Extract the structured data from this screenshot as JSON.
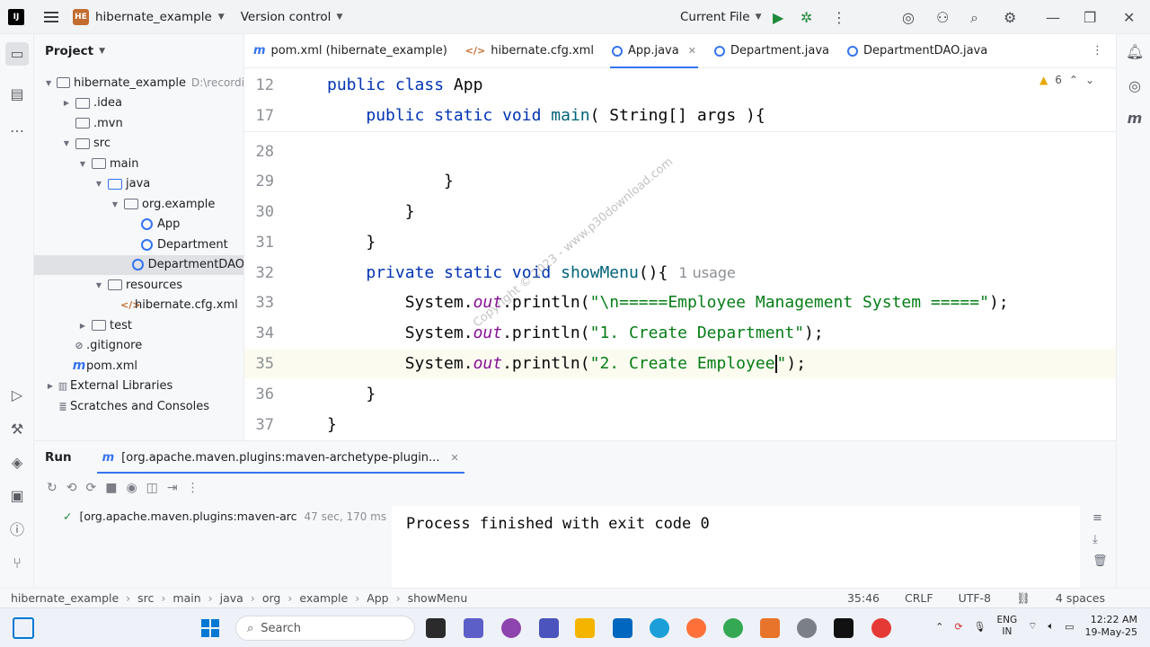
{
  "titlebar": {
    "project_badge": "HE",
    "project_name": "hibernate_example",
    "version_control": "Version control",
    "current_file": "Current File"
  },
  "project_panel": {
    "title": "Project",
    "tree": [
      {
        "label": "hibernate_example",
        "sub": "D:\\recordi",
        "indent": 0,
        "arrow": "▼",
        "icon": "folder"
      },
      {
        "label": ".idea",
        "indent": 1,
        "arrow": "▶",
        "icon": "folder"
      },
      {
        "label": ".mvn",
        "indent": 1,
        "arrow": "",
        "icon": "folder"
      },
      {
        "label": "src",
        "indent": 1,
        "arrow": "▼",
        "icon": "folder"
      },
      {
        "label": "main",
        "indent": 2,
        "arrow": "▼",
        "icon": "folder"
      },
      {
        "label": "java",
        "indent": 3,
        "arrow": "▼",
        "icon": "folder-blue"
      },
      {
        "label": "org.example",
        "indent": 4,
        "arrow": "▼",
        "icon": "folder"
      },
      {
        "label": "App",
        "indent": 5,
        "arrow": "",
        "icon": "class"
      },
      {
        "label": "Department",
        "indent": 5,
        "arrow": "",
        "icon": "class"
      },
      {
        "label": "DepartmentDAO",
        "indent": 5,
        "arrow": "",
        "icon": "class",
        "selected": true
      },
      {
        "label": "resources",
        "indent": 3,
        "arrow": "▼",
        "icon": "folder-res"
      },
      {
        "label": "hibernate.cfg.xml",
        "indent": 4,
        "arrow": "",
        "icon": "xml"
      },
      {
        "label": "test",
        "indent": 2,
        "arrow": "▶",
        "icon": "folder"
      },
      {
        "label": ".gitignore",
        "indent": 1,
        "arrow": "",
        "icon": "gitignore"
      },
      {
        "label": "pom.xml",
        "indent": 1,
        "arrow": "",
        "icon": "maven"
      },
      {
        "label": "External Libraries",
        "indent": 0,
        "arrow": "▶",
        "icon": "library"
      },
      {
        "label": "Scratches and Consoles",
        "indent": 0,
        "arrow": "",
        "icon": "scratch"
      }
    ]
  },
  "tabs": [
    {
      "label": "pom.xml (hibernate_example)",
      "icon": "m",
      "active": false
    },
    {
      "label": "hibernate.cfg.xml",
      "icon": "x",
      "active": false
    },
    {
      "label": "App.java",
      "icon": "c",
      "active": true
    },
    {
      "label": "Department.java",
      "icon": "c",
      "active": false
    },
    {
      "label": "DepartmentDAO.java",
      "icon": "c",
      "active": false
    }
  ],
  "editor": {
    "warnings_count": "6",
    "usage_hint": "1 usage",
    "watermark": "Copyright © 2023 - www.p30download.com",
    "lines": [
      {
        "n": "12",
        "parts": [
          [
            "kw",
            "public class "
          ],
          [
            "",
            "App"
          ]
        ]
      },
      {
        "n": "17",
        "parts": [
          [
            "",
            "    "
          ],
          [
            "kw",
            "public static void "
          ],
          [
            "fn",
            "main"
          ],
          [
            "",
            "( String[] args ){"
          ]
        ]
      },
      {
        "n": "28",
        "parts": [
          [
            "",
            ""
          ]
        ]
      },
      {
        "n": "29",
        "parts": [
          [
            "",
            "            }"
          ]
        ]
      },
      {
        "n": "30",
        "parts": [
          [
            "",
            "        }"
          ]
        ]
      },
      {
        "n": "31",
        "parts": [
          [
            "",
            "    }"
          ]
        ]
      },
      {
        "n": "32",
        "parts": [
          [
            "",
            "    "
          ],
          [
            "kw",
            "private static void "
          ],
          [
            "fn",
            "showMenu"
          ],
          [
            "",
            "(){"
          ]
        ]
      },
      {
        "n": "33",
        "parts": [
          [
            "",
            "        System."
          ],
          [
            "fld",
            "out"
          ],
          [
            "",
            ".println("
          ],
          [
            "str",
            "\"\\n=====Employee Management System =====\""
          ],
          [
            "",
            ");"
          ]
        ]
      },
      {
        "n": "34",
        "parts": [
          [
            "",
            "        System."
          ],
          [
            "fld",
            "out"
          ],
          [
            "",
            ".println("
          ],
          [
            "str",
            "\"1. Create Department\""
          ],
          [
            "",
            ");"
          ]
        ]
      },
      {
        "n": "35",
        "parts": [
          [
            "",
            "        System."
          ],
          [
            "fld",
            "out"
          ],
          [
            "",
            ".println("
          ],
          [
            "str",
            "\"2. Create Employee"
          ],
          [
            "cursor",
            ""
          ],
          [
            "str",
            "\""
          ],
          [
            "",
            ");"
          ]
        ]
      },
      {
        "n": "36",
        "parts": [
          [
            "",
            "    }"
          ]
        ]
      },
      {
        "n": "37",
        "parts": [
          [
            "",
            "}"
          ]
        ]
      }
    ]
  },
  "run_panel": {
    "title": "Run",
    "tab_label": "[org.apache.maven.plugins:maven-archetype-plugin...",
    "tree_item": "[org.apache.maven.plugins:maven-arc",
    "tree_time": "47 sec, 170 ms",
    "console_output": "Process finished with exit code 0"
  },
  "statusbar": {
    "breadcrumbs": [
      "hibernate_example",
      "src",
      "main",
      "java",
      "org",
      "example",
      "App",
      "showMenu"
    ],
    "position": "35:46",
    "line_ending": "CRLF",
    "encoding": "UTF-8",
    "indent": "4 spaces"
  },
  "taskbar": {
    "search_placeholder": "Search",
    "lang_line1": "ENG",
    "lang_line2": "IN",
    "time": "12:22 AM",
    "date": "19-May-25"
  }
}
